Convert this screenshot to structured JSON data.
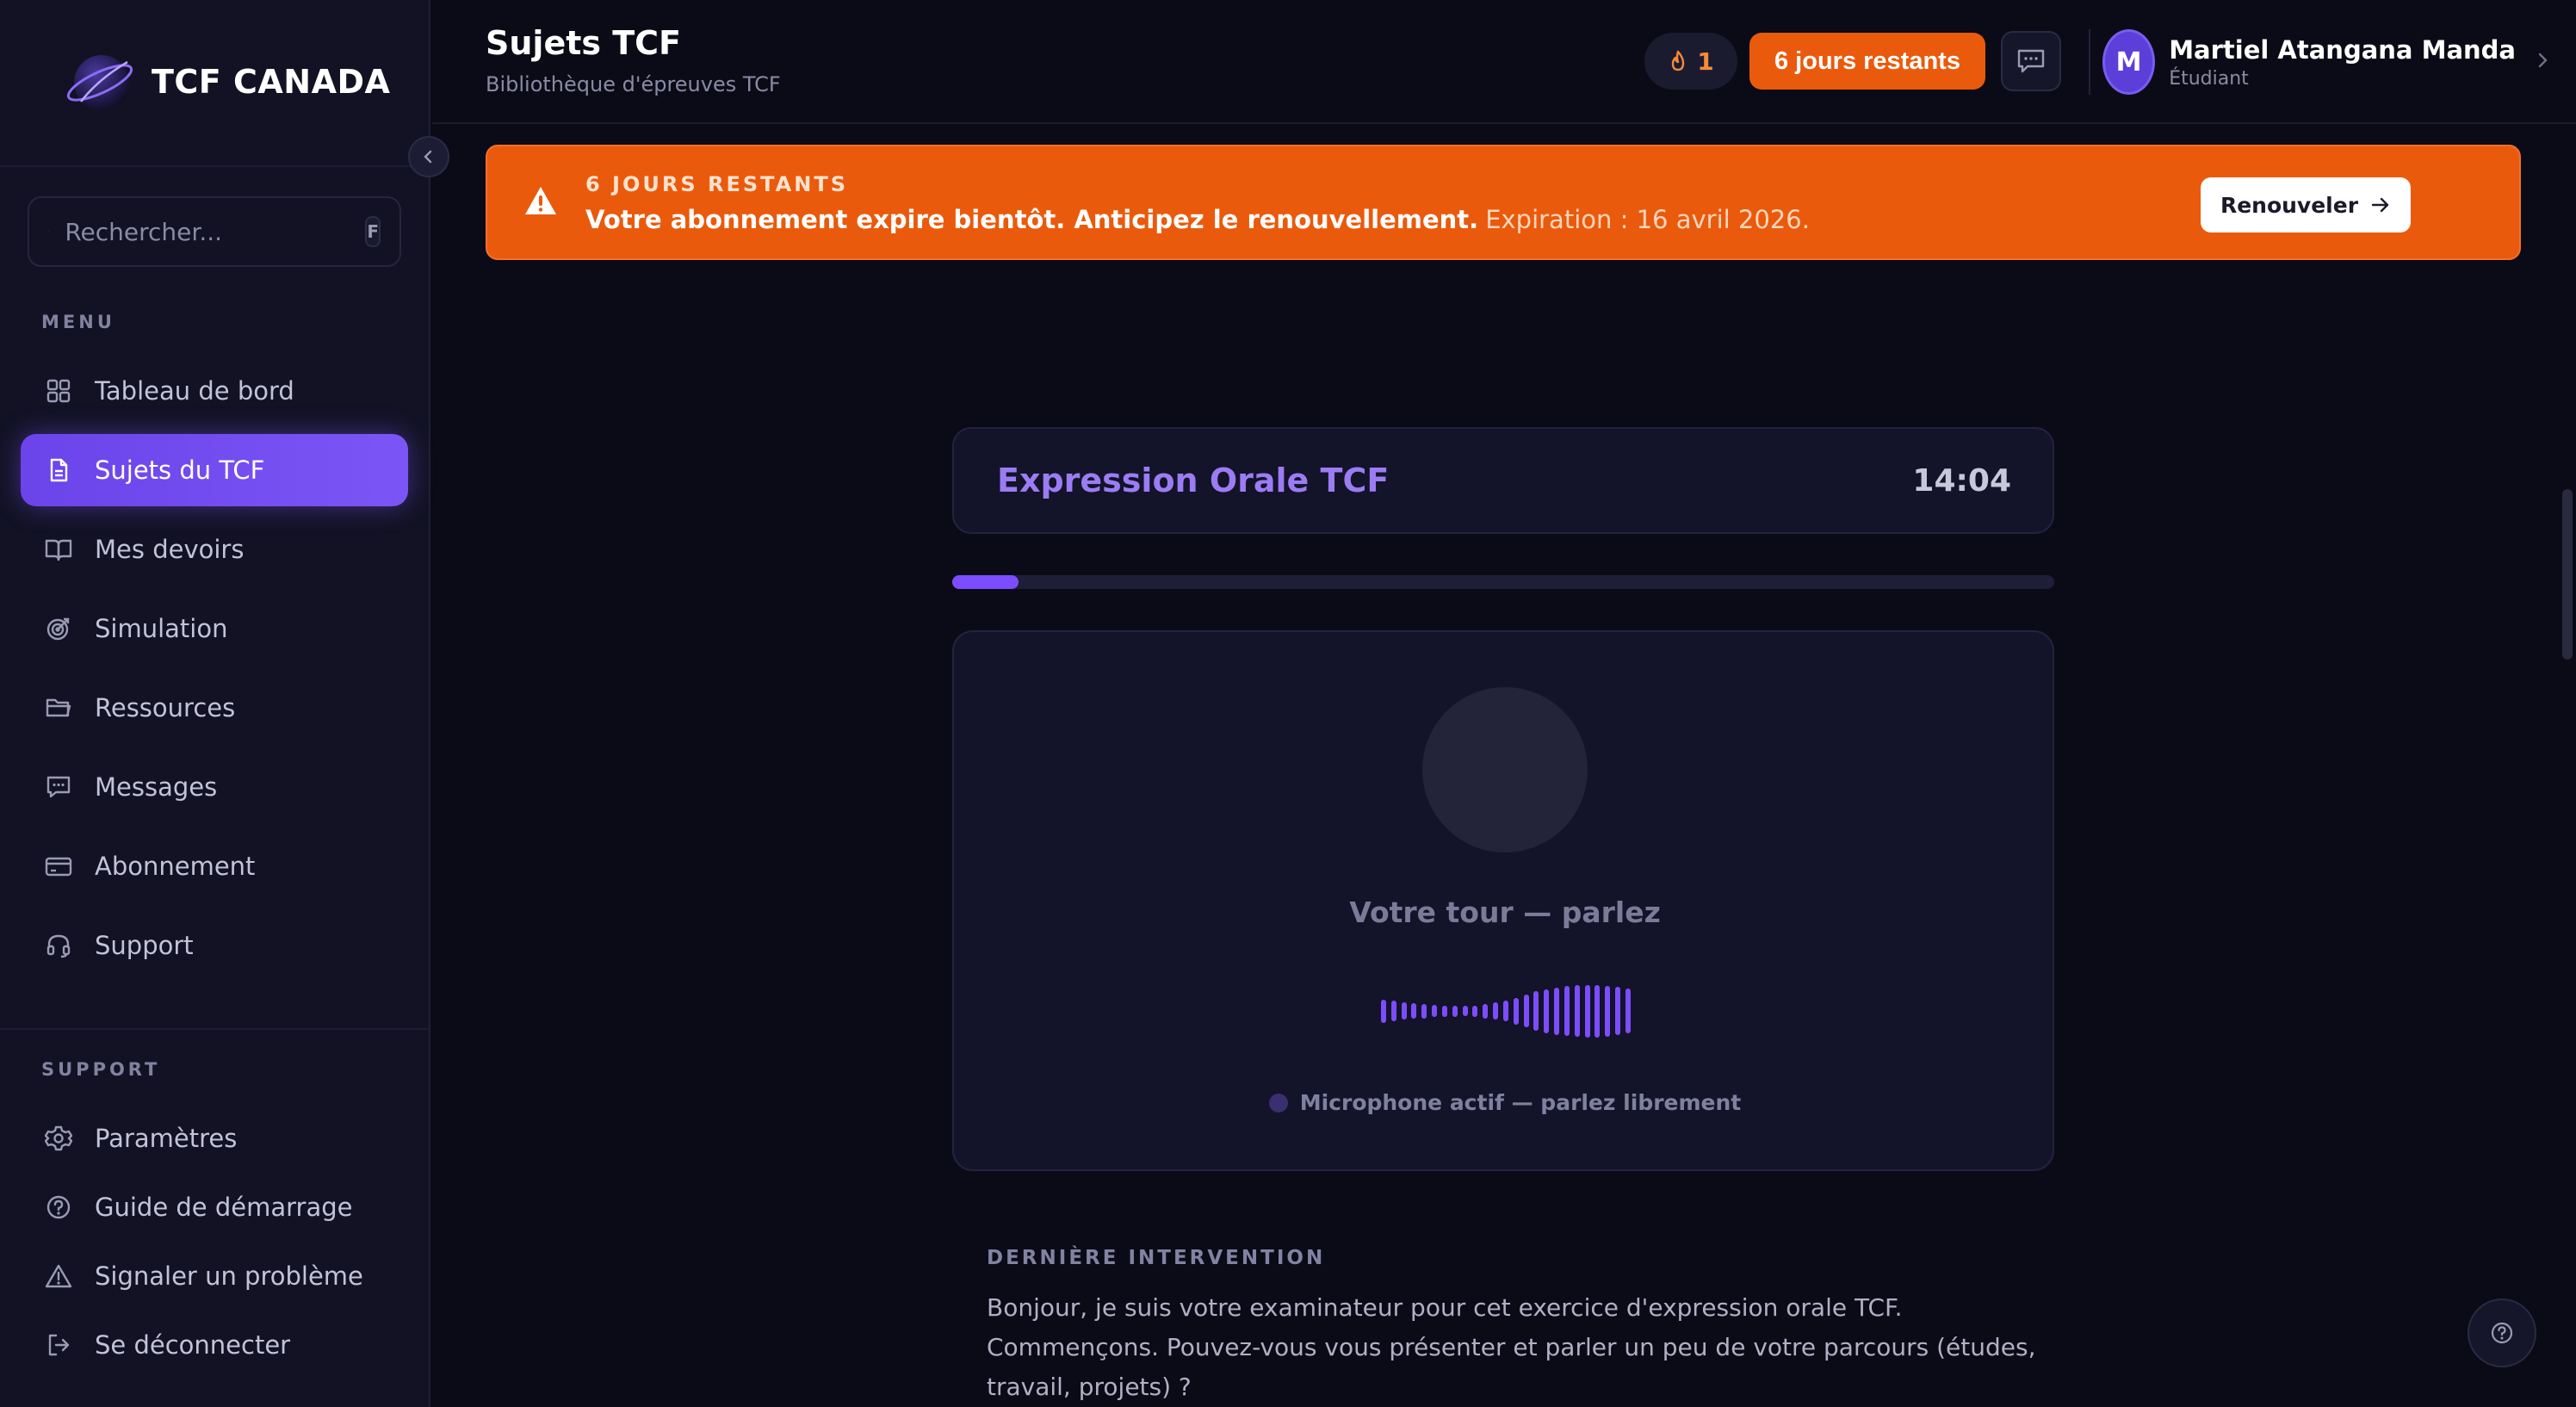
{
  "brand": {
    "name": "TCF CANADA"
  },
  "search": {
    "placeholder": "Rechercher...",
    "shortcut": "F"
  },
  "sidebar": {
    "menu_label": "MENU",
    "menu_items": [
      {
        "label": "Tableau de bord",
        "icon": "grid-icon"
      },
      {
        "label": "Sujets du TCF",
        "icon": "document-icon",
        "active": true
      },
      {
        "label": "Mes devoirs",
        "icon": "book-icon"
      },
      {
        "label": "Simulation",
        "icon": "target-icon"
      },
      {
        "label": "Ressources",
        "icon": "folder-icon"
      },
      {
        "label": "Messages",
        "icon": "chat-icon"
      },
      {
        "label": "Abonnement",
        "icon": "card-icon"
      },
      {
        "label": "Support",
        "icon": "headset-icon"
      }
    ],
    "support_label": "SUPPORT",
    "support_items": [
      {
        "label": "Paramètres",
        "icon": "gear-icon"
      },
      {
        "label": "Guide de démarrage",
        "icon": "help-circle-icon"
      },
      {
        "label": "Signaler un problème",
        "icon": "warning-icon"
      },
      {
        "label": "Se déconnecter",
        "icon": "logout-icon"
      }
    ]
  },
  "header": {
    "title": "Sujets TCF",
    "subtitle": "Bibliothèque d'épreuves TCF",
    "streak": "1",
    "days_left": "6 jours restants",
    "user": {
      "initial": "M",
      "name": "Martiel Atangana Manda",
      "role": "Étudiant"
    }
  },
  "alert": {
    "kicker": "6 JOURS RESTANTS",
    "message": "Votre abonnement expire bientôt. Anticipez le renouvellement.",
    "expiration": "Expiration : 16 avril 2026.",
    "button": "Renouveler"
  },
  "exam": {
    "title": "Expression Orale TCF",
    "timer": "14:04",
    "progress": 0.06,
    "turn_label": "Votre tour — parlez",
    "mic_status": "Microphone actif — parlez librement",
    "waveform": [
      0.42,
      0.38,
      0.32,
      0.28,
      0.26,
      0.22,
      0.2,
      0.2,
      0.18,
      0.2,
      0.26,
      0.32,
      0.38,
      0.48,
      0.6,
      0.72,
      0.8,
      0.86,
      0.9,
      0.94,
      0.96,
      0.96,
      0.92,
      0.88,
      0.82
    ]
  },
  "last_intervention": {
    "label": "DERNIÈRE INTERVENTION",
    "text": "Bonjour, je suis votre examinateur pour cet exercice d'expression orale TCF. Commençons. Pouvez-vous vous présenter et parler un peu de votre parcours (études, travail, projets) ?"
  },
  "colors": {
    "accent": "#7c4dff",
    "warning": "#ea5a0c",
    "background": "#0b0b17"
  }
}
